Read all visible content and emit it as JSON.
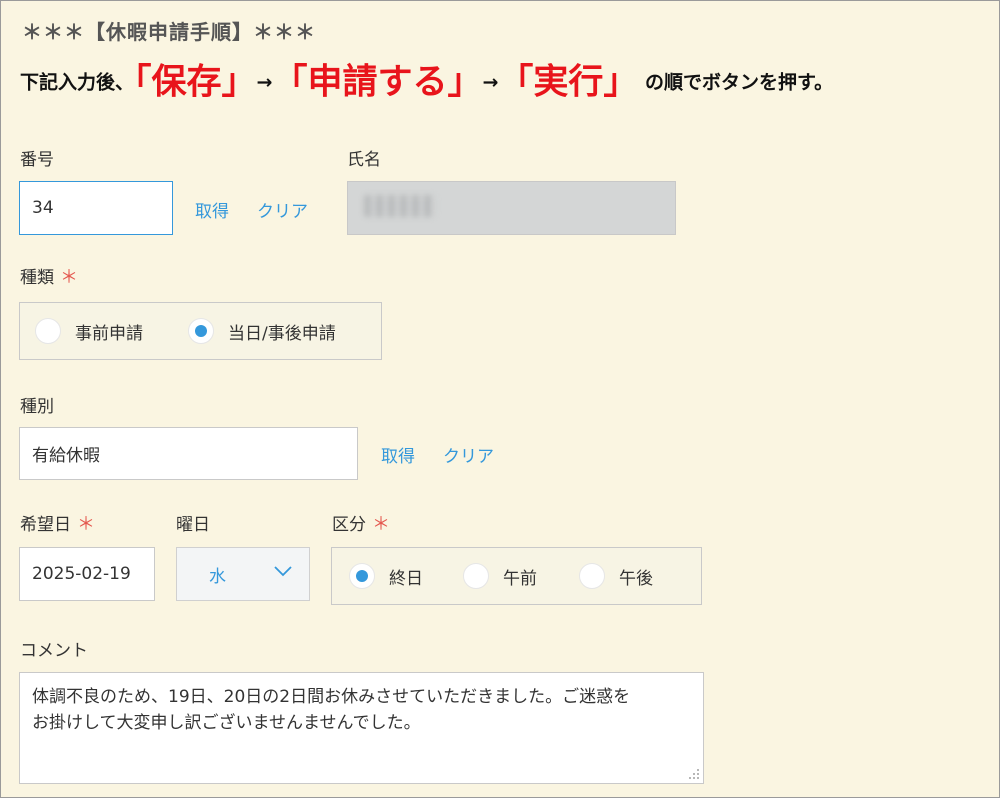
{
  "instructions": {
    "heading": "＊＊＊【休暇申請手順】＊＊＊",
    "prefix": "下記入力後、",
    "step1": "「保存」",
    "arrow1": "→",
    "step2": "「申請する」",
    "arrow2": "→",
    "step3": "「実行」",
    "suffix": " の順でボタンを押す。"
  },
  "number": {
    "label": "番号",
    "value": "34",
    "get_link": "取得",
    "clear_link": "クリア"
  },
  "name": {
    "label": "氏名"
  },
  "type": {
    "label": "種類",
    "required_mark": "＊",
    "options": [
      "事前申請",
      "当日/事後申請"
    ],
    "selected": "当日/事後申請"
  },
  "category": {
    "label": "種別",
    "value": "有給休暇",
    "get_link": "取得",
    "clear_link": "クリア"
  },
  "desired_date": {
    "label": "希望日",
    "required_mark": "＊",
    "value": "2025-02-19"
  },
  "weekday": {
    "label": "曜日",
    "value": "水"
  },
  "division": {
    "label": "区分",
    "required_mark": "＊",
    "options": [
      "終日",
      "午前",
      "午後"
    ],
    "selected": "終日"
  },
  "comment": {
    "label": "コメント",
    "lines": [
      "体調不良のため、19日、20日の2日間お休みさせていただきました。ご迷惑を",
      "お掛けして大変申し訳ございませんませんでした。"
    ]
  },
  "colors": {
    "background": "#faf5e1",
    "accent": "#3498db",
    "emphasis": "#e8141b",
    "required": "#e4584f"
  }
}
